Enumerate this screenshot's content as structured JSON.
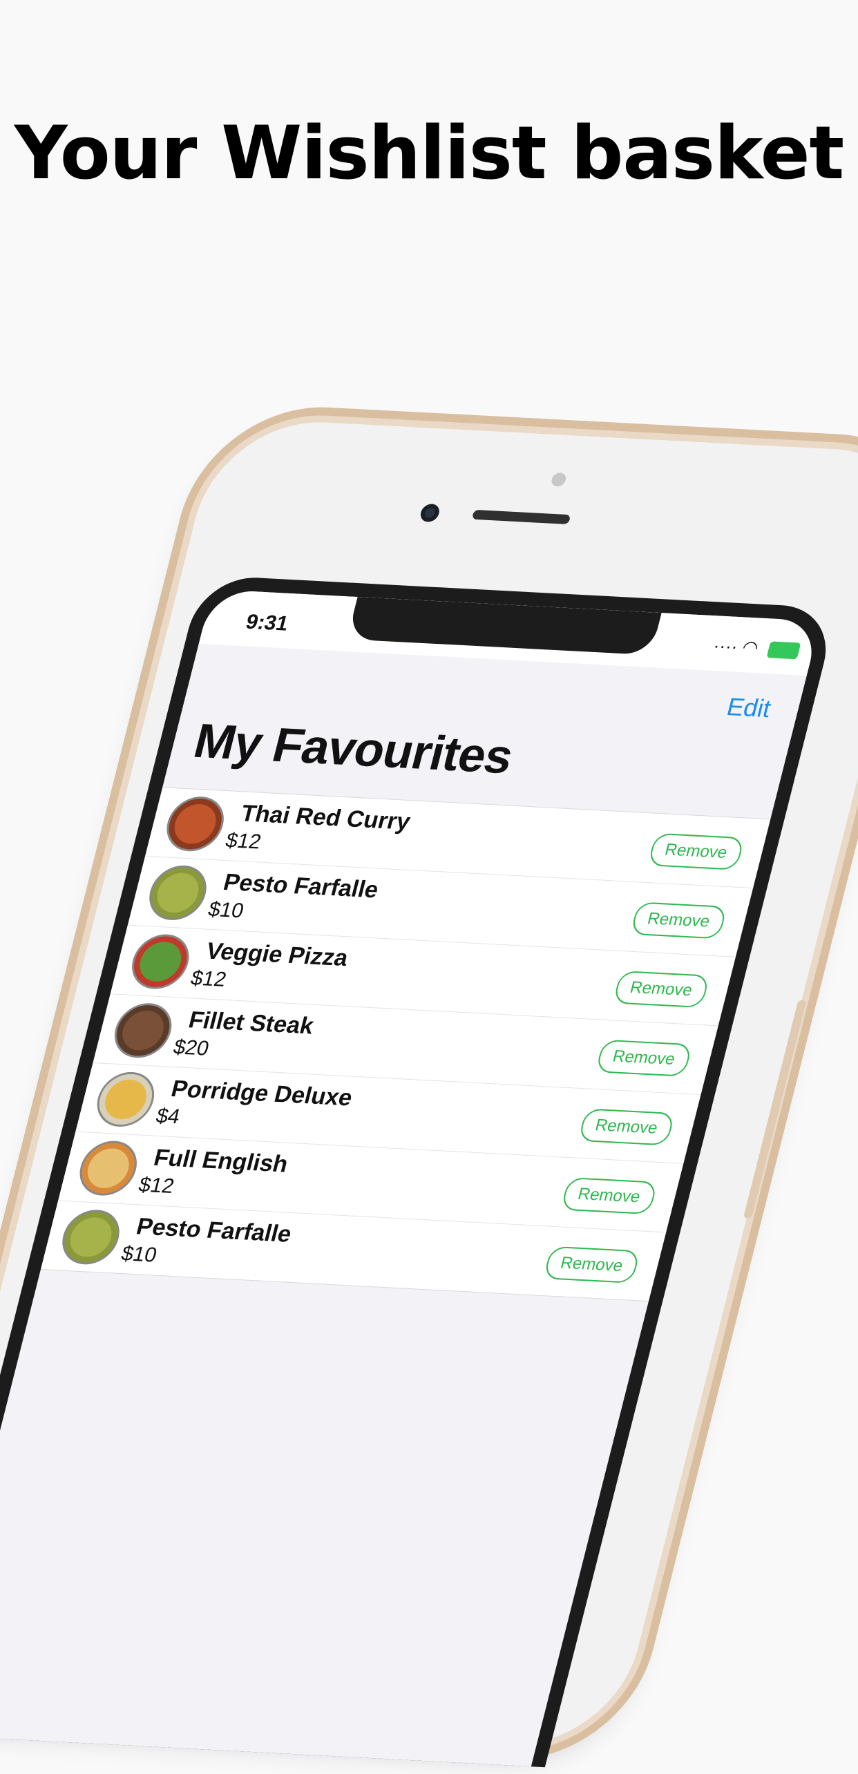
{
  "promo": {
    "headline": "Your Wishlist basket"
  },
  "status_bar": {
    "time": "9:31"
  },
  "nav": {
    "edit_label": "Edit",
    "title": "My Favourites"
  },
  "items": [
    {
      "name": "Thai Red Curry",
      "price": "$12",
      "remove_label": "Remove",
      "thumb_color": "#8b3a1e",
      "plate_color": "#c2552b"
    },
    {
      "name": "Pesto Farfalle",
      "price": "$10",
      "remove_label": "Remove",
      "thumb_color": "#8a9a3a",
      "plate_color": "#a6b24a"
    },
    {
      "name": "Veggie Pizza",
      "price": "$12",
      "remove_label": "Remove",
      "thumb_color": "#c0392b",
      "plate_color": "#5a9a3a"
    },
    {
      "name": "Fillet Steak",
      "price": "$20",
      "remove_label": "Remove",
      "thumb_color": "#5a3a28",
      "plate_color": "#7a5038"
    },
    {
      "name": "Porridge Deluxe",
      "price": "$4",
      "remove_label": "Remove",
      "thumb_color": "#d8d0b8",
      "plate_color": "#e6b84a"
    },
    {
      "name": "Full English",
      "price": "$12",
      "remove_label": "Remove",
      "thumb_color": "#d88a3a",
      "plate_color": "#e6c070"
    },
    {
      "name": "Pesto Farfalle",
      "price": "$10",
      "remove_label": "Remove",
      "thumb_color": "#8a9a3a",
      "plate_color": "#a6b24a"
    }
  ],
  "colors": {
    "accent_blue": "#1a8cf0",
    "remove_green": "#2fb84e",
    "phone_gold": "#d9bea0"
  }
}
